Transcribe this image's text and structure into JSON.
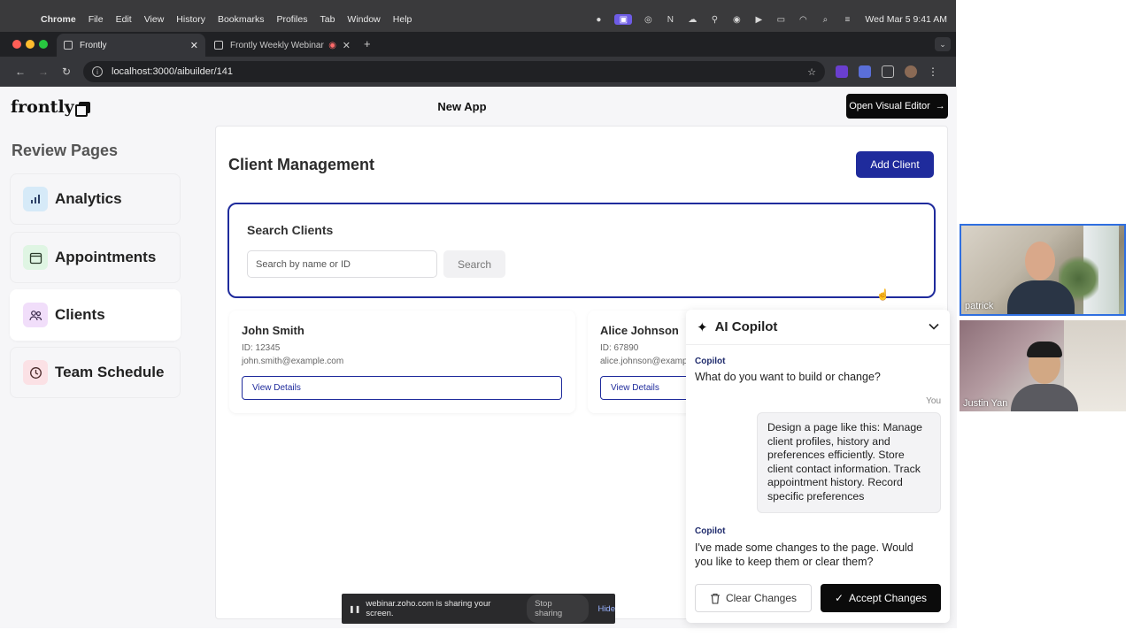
{
  "menubar": {
    "items": [
      "Chrome",
      "File",
      "Edit",
      "View",
      "History",
      "Bookmarks",
      "Profiles",
      "Tab",
      "Window",
      "Help"
    ],
    "datetime": "Wed Mar 5  9:41 AM"
  },
  "browser": {
    "tabs": [
      {
        "label": "Frontly"
      },
      {
        "label": "Frontly Weekly Webinar"
      }
    ],
    "url": "localhost:3000/aibuilder/141"
  },
  "app": {
    "logo_text": "frontly",
    "title": "New App",
    "open_editor_label": "Open Visual Editor",
    "sidebar": {
      "heading": "Review Pages",
      "items": [
        {
          "label": "Analytics",
          "icon": "bar-chart-icon",
          "color": "#d6eaf8"
        },
        {
          "label": "Appointments",
          "icon": "calendar-icon",
          "color": "#dff5e3"
        },
        {
          "label": "Clients",
          "icon": "users-icon",
          "color": "#f1defa"
        },
        {
          "label": "Team Schedule",
          "icon": "clock-icon",
          "color": "#fbe1e5"
        }
      ]
    },
    "page": {
      "heading": "Client Management",
      "add_button": "Add Client",
      "search": {
        "title": "Search Clients",
        "placeholder": "Search by name or ID",
        "button": "Search"
      },
      "clients": [
        {
          "name": "John Smith",
          "id": "ID: 12345",
          "email": "john.smith@example.com",
          "button": "View Details"
        },
        {
          "name": "Alice Johnson",
          "id": "ID: 67890",
          "email": "alice.johnson@examp",
          "button": "View Details"
        }
      ]
    },
    "accent_color": "#1f2b9c"
  },
  "copilot": {
    "title": "AI Copilot",
    "messages": [
      {
        "sender": "Copilot",
        "text": "What do you want to build or change?"
      },
      {
        "sender": "You",
        "text": "Design a page like this: Manage client profiles, history and preferences efficiently. Store client contact information. Track appointment history. Record specific preferences"
      },
      {
        "sender": "Copilot",
        "text": "I've made some changes to the page. Would you like to keep them or clear them?"
      }
    ],
    "clear_label": "Clear Changes",
    "accept_label": "Accept Changes"
  },
  "screen_share": {
    "message": "webinar.zoho.com is sharing your screen.",
    "stop_label": "Stop sharing",
    "hide_label": "Hide"
  },
  "participants": [
    {
      "name": "patrick"
    },
    {
      "name": "Justin Yan"
    }
  ]
}
